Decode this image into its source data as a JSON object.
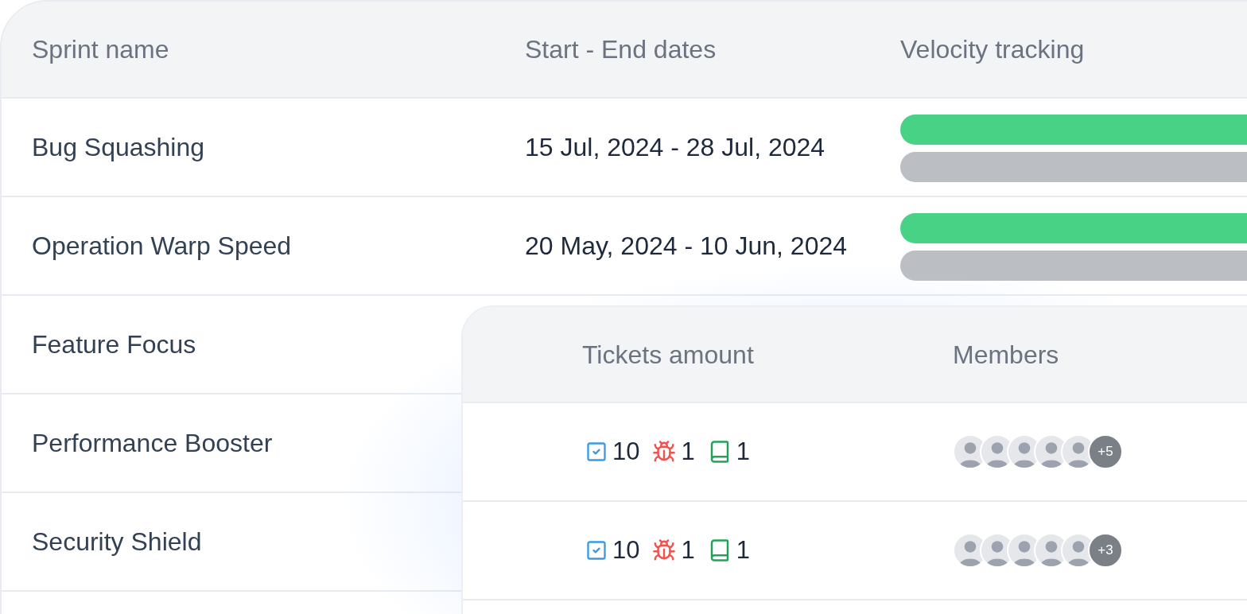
{
  "sprints_table": {
    "columns": [
      "Sprint name",
      "Start - End dates",
      "Velocity tracking"
    ],
    "rows": [
      {
        "name": "Bug Squashing",
        "dates": "15 Jul, 2024 - 28 Jul, 2024",
        "velocity": {
          "level": 1
        }
      },
      {
        "name": "Operation Warp Speed",
        "dates": "20 May, 2024 - 10 Jun, 2024",
        "velocity": {
          "level": 1
        }
      },
      {
        "name": "Feature Focus"
      },
      {
        "name": "Performance Booster"
      },
      {
        "name": "Security Shield"
      }
    ]
  },
  "detail_card": {
    "columns": [
      "Tickets amount",
      "Members"
    ],
    "rows": [
      {
        "tickets": [
          {
            "kind": "task",
            "count": "10"
          },
          {
            "kind": "bug",
            "count": "1"
          },
          {
            "kind": "story",
            "count": "1"
          }
        ],
        "more_members": "+5"
      },
      {
        "tickets": [
          {
            "kind": "task",
            "count": "10"
          },
          {
            "kind": "bug",
            "count": "1"
          },
          {
            "kind": "story",
            "count": "1"
          }
        ],
        "more_members": "+3"
      }
    ]
  }
}
